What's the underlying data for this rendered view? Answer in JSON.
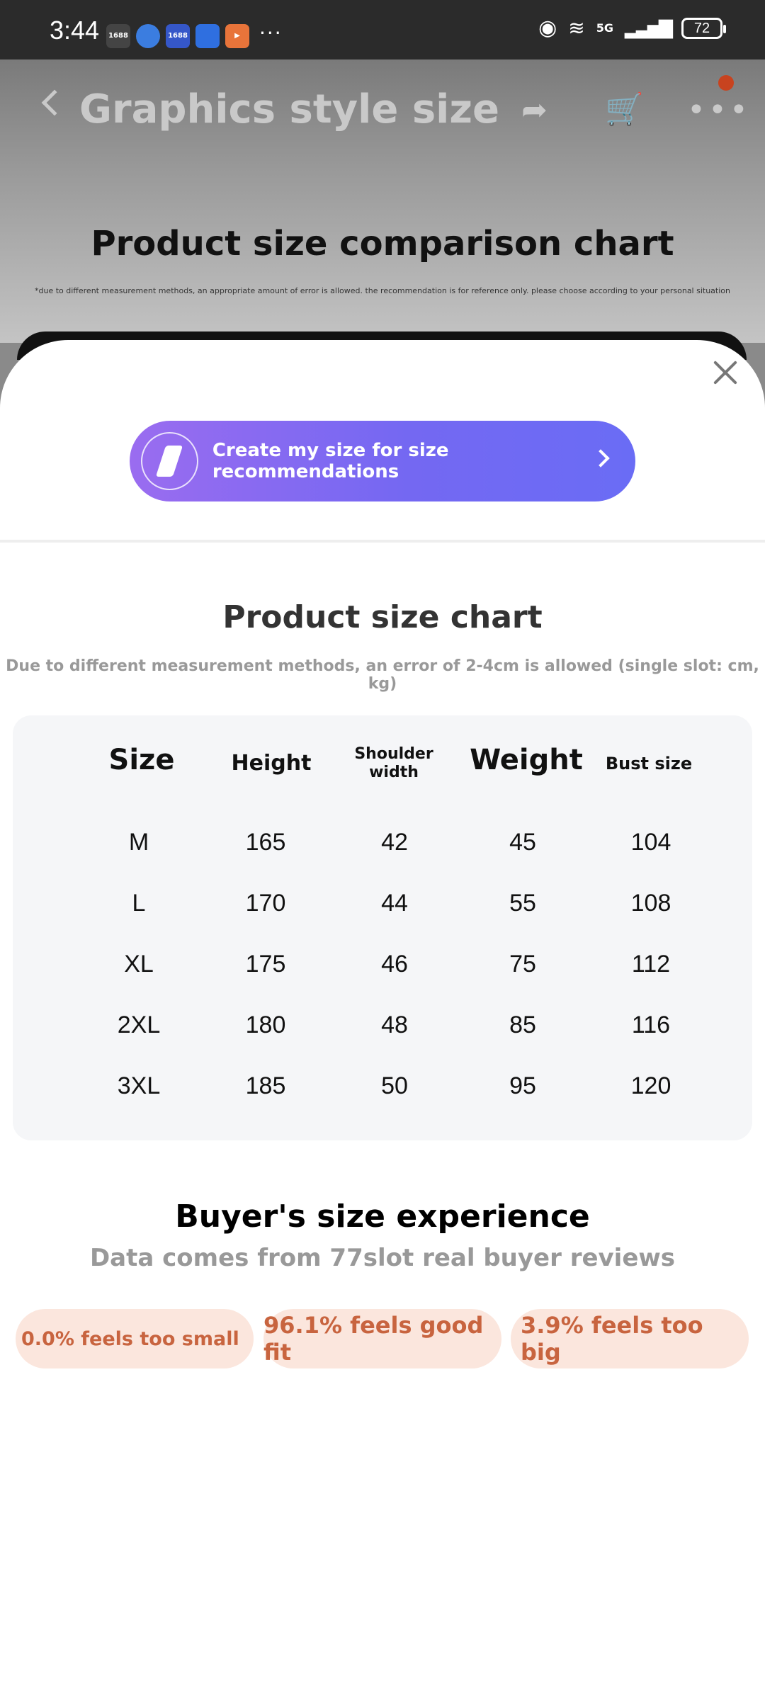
{
  "status_bar": {
    "time": "3:44",
    "app_icons": [
      "1688",
      "browser",
      "1688",
      "app",
      "play"
    ],
    "more": "···",
    "network": "5G",
    "battery": "72"
  },
  "background_page": {
    "title": "Graphics style size",
    "heading": "Product size comparison chart",
    "note": "*due to different measurement methods, an appropriate amount of error is allowed. the recommendation is for reference only. please choose according to your personal situation"
  },
  "sheet": {
    "cta_label": "Create my size for size recommendations",
    "chart_title": "Product size chart",
    "chart_subtitle": "Due to different measurement methods, an error of 2-4cm is allowed (single slot: cm, kg)",
    "table": {
      "headers": [
        "Size",
        "Height",
        "Shoulder width",
        "Weight",
        "Bust size"
      ],
      "rows": [
        [
          "M",
          "165",
          "42",
          "45",
          "104"
        ],
        [
          "L",
          "170",
          "44",
          "55",
          "108"
        ],
        [
          "XL",
          "175",
          "46",
          "75",
          "112"
        ],
        [
          "2XL",
          "180",
          "48",
          "85",
          "116"
        ],
        [
          "3XL",
          "185",
          "50",
          "95",
          "120"
        ]
      ]
    },
    "experience": {
      "title": "Buyer's size experience",
      "subtitle": "Data comes from 77slot real buyer reviews",
      "pills": [
        "0.0% feels too small",
        "96.1% feels good fit",
        "3.9% feels too big"
      ]
    }
  },
  "colors": {
    "cta_gradient_start": "#9a6cf0",
    "cta_gradient_end": "#6a6cf5",
    "pill_bg": "#fbe6dd",
    "pill_text": "#c8643f",
    "notification_dot": "#c8431f"
  }
}
